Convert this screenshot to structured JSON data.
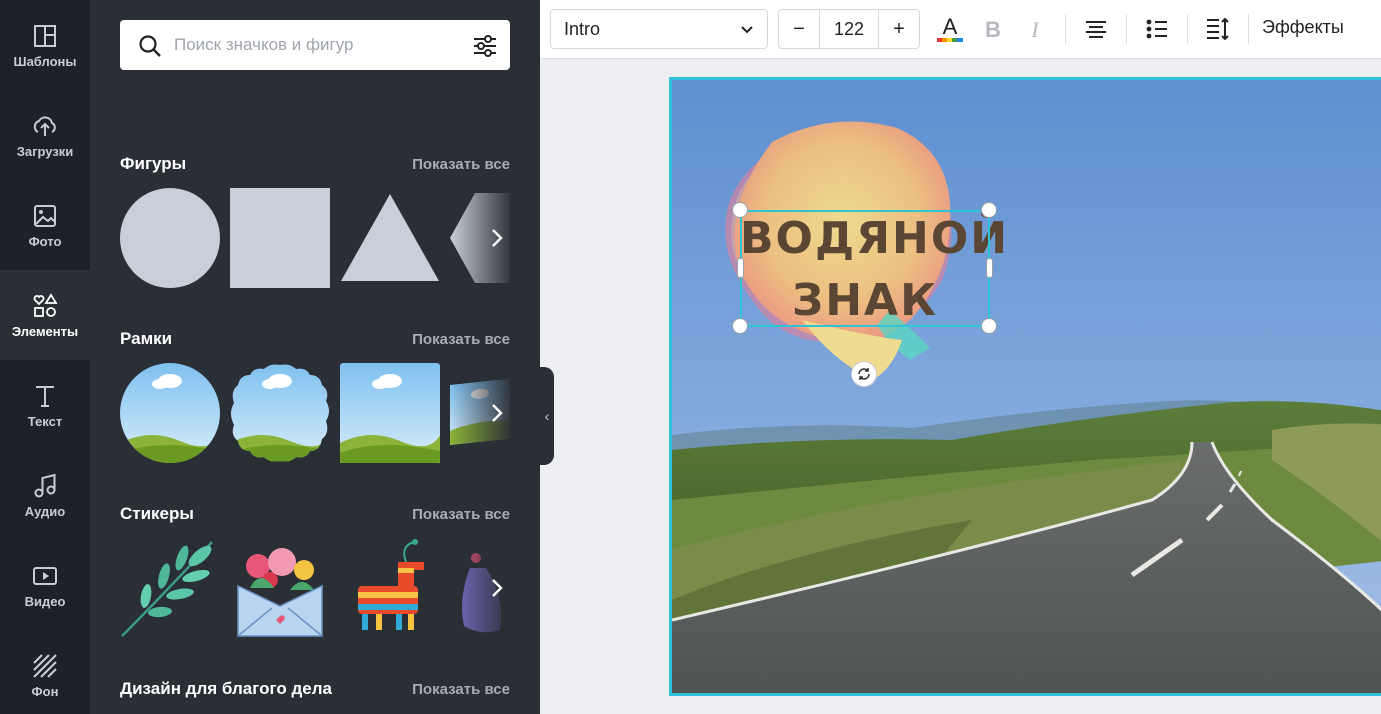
{
  "rail": {
    "items": [
      {
        "label": "Шаблоны",
        "icon": "templates-icon"
      },
      {
        "label": "Загрузки",
        "icon": "upload-icon"
      },
      {
        "label": "Фото",
        "icon": "photo-icon"
      },
      {
        "label": "Элементы",
        "icon": "elements-icon",
        "active": true
      },
      {
        "label": "Текст",
        "icon": "text-icon"
      },
      {
        "label": "Аудио",
        "icon": "audio-icon"
      },
      {
        "label": "Видео",
        "icon": "video-icon"
      },
      {
        "label": "Фон",
        "icon": "background-icon"
      }
    ]
  },
  "panel": {
    "search": {
      "placeholder": "Поиск значков и фигур",
      "value": ""
    },
    "sections": [
      {
        "title": "Фигуры",
        "show_all": "Показать все"
      },
      {
        "title": "Рамки",
        "show_all": "Показать все"
      },
      {
        "title": "Стикеры",
        "show_all": "Показать все"
      },
      {
        "title": "Дизайн для благого дела",
        "show_all": "Показать все"
      }
    ]
  },
  "toolbar": {
    "font": "Intro",
    "font_size": "122",
    "minus": "−",
    "plus": "+",
    "effects": "Эффекты"
  },
  "canvas": {
    "text_line1": "ВОДЯНОЙ",
    "text_line2": "ЗНАК",
    "accent_color": "#2ec4d6",
    "text_color": "#5a4632"
  }
}
